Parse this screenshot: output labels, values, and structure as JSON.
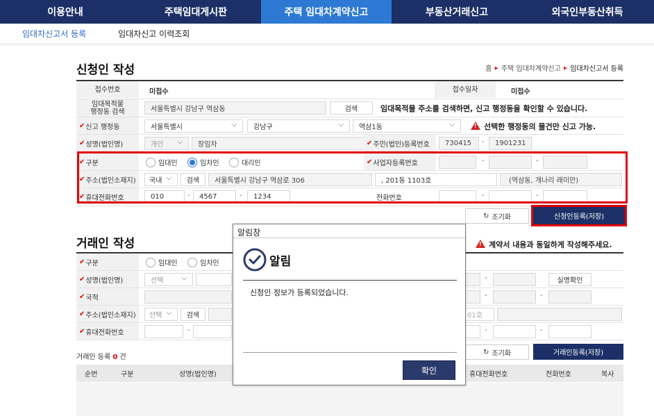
{
  "nav": {
    "items": [
      "이용안내",
      "주택임대게시판",
      "주택 임대차계약신고",
      "부동산거래신고",
      "외국인부동산취득"
    ],
    "active": 2
  },
  "subnav": {
    "items": [
      "임대차신고서 등록",
      "임대차신고 이력조회"
    ]
  },
  "applicant": {
    "title": "신청인 작성",
    "breadcrumb": [
      "홈",
      "주택 임대차계약신고",
      "임대차신고서 등록"
    ],
    "receipt_no_label": "접수번호",
    "receipt_no_value": "미접수",
    "receipt_date_label": "접수일자",
    "receipt_date_value": "미접수",
    "dong_search_label": "임대목적물 행정동 검색",
    "dong_search_value": "서울특별시 강남구 역삼동",
    "search_btn": "검색",
    "dong_notice": "임대목적물 주소를 검색하면, 신고 행정동을 확인할 수 있습니다.",
    "report_dong_label": "신고 행정동",
    "sido": "서울특별시",
    "sigungu": "강남구",
    "dong": "역삼1동",
    "dong_warning": "선택한 행정동의 물건만 신고 가능.",
    "name_label": "성명(법인명)",
    "person_type": "개인",
    "name_value": "장임차",
    "id_no_label": "주민(법인)등록번호",
    "id_no_front": "730415",
    "id_no_back": "1901231",
    "type_label": "구분",
    "type_options": [
      "임대인",
      "임차인",
      "대리인"
    ],
    "type_selected": 1,
    "biz_no_label": "사업자등록번호",
    "addr_label": "주소(법인소재지)",
    "addr_domestic": "국내",
    "addr_search_btn": "검색",
    "addr_road": "서울특별시 강남구 역삼로 306",
    "addr_detail": ", 201동 1103호",
    "addr_extra": "(역삼동, 개나리 래미안)",
    "mobile_label": "휴대전화번호",
    "mobile": [
      "010",
      "4567",
      "1234"
    ],
    "phone_label": "전화번호",
    "reset_btn": "조기화",
    "save_btn": "신청인등록(저장)"
  },
  "counterpart": {
    "title": "거래인 작성",
    "warning": "계약서 내용과 동일하게 작성해주세요.",
    "type_label": "구분",
    "type_options": [
      "임대인",
      "임차인"
    ],
    "name_label": "성명(법인명)",
    "name_select": "선택",
    "verify_btn": "실명확인",
    "nationality_label": "국적",
    "addr_label": "주소(법인소재지)",
    "addr_select": "선택",
    "addr_search_btn": "검색",
    "addr_partial": "01호",
    "mobile_label": "휴대전화번호",
    "reset_btn": "조기화",
    "save_btn": "거래인등록(저장)",
    "count_prefix": "거래인 등록",
    "count": "0",
    "count_suffix": "건",
    "columns": [
      "순번",
      "구분",
      "성명(법인명)",
      "휴대전화번호",
      "전화번호",
      "복사"
    ]
  },
  "modal": {
    "window_title": "알림창",
    "heading": "알림",
    "message": "신청인 정보가 등록되었습니다.",
    "ok_btn": "확인"
  }
}
